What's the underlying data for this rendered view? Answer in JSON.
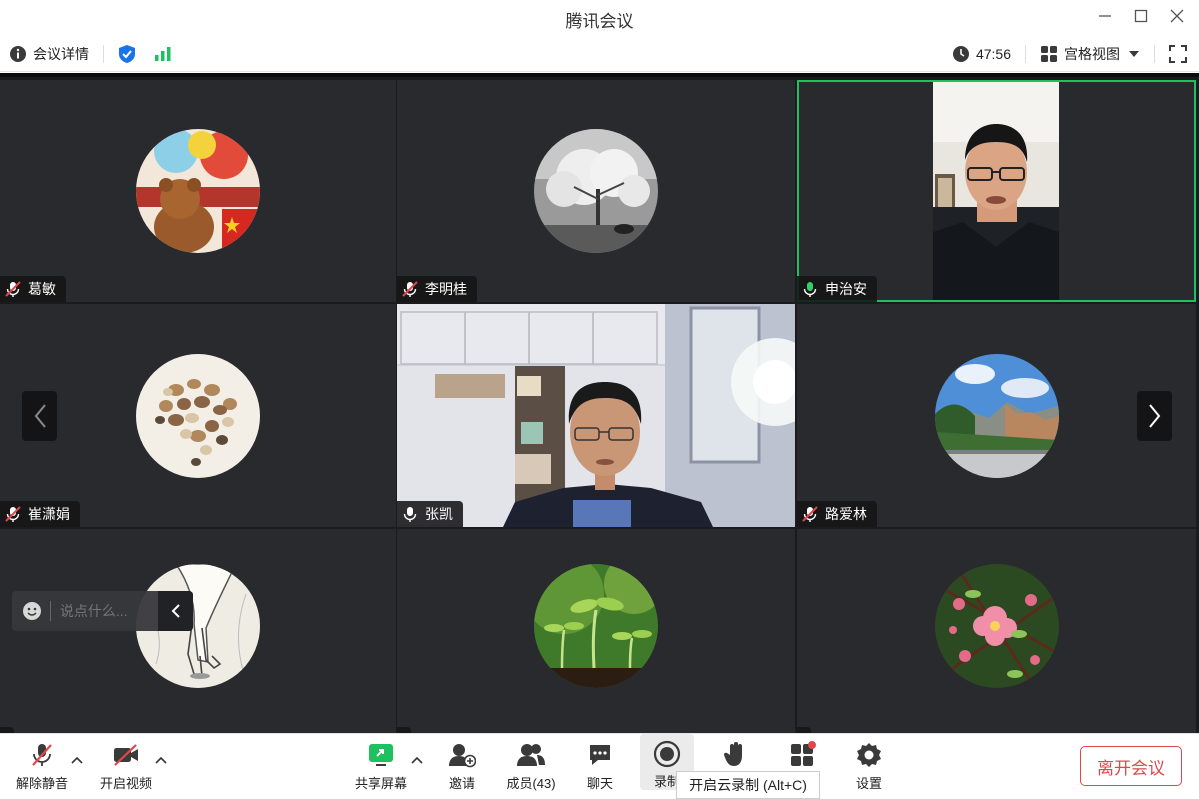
{
  "window": {
    "title": "腾讯会议"
  },
  "infobar": {
    "details_label": "会议详情",
    "timer": "47:56",
    "view_label": "宫格视图"
  },
  "tiles": [
    {
      "name": "葛敏",
      "mic": "muted"
    },
    {
      "name": "李明桂",
      "mic": "muted"
    },
    {
      "name": "申治安",
      "mic": "on",
      "active": true
    },
    {
      "name": "崔潇娟",
      "mic": "muted"
    },
    {
      "name": "张凯",
      "mic": "on"
    },
    {
      "name": "路爱林",
      "mic": "muted"
    }
  ],
  "chat": {
    "placeholder": "说点什么..."
  },
  "toolbar": {
    "unmute": "解除静音",
    "video": "开启视频",
    "share": "共享屏幕",
    "invite": "邀请",
    "members": "成员(43)",
    "chat": "聊天",
    "record": "录制",
    "raise": "",
    "apps": "",
    "settings": "设置",
    "leave": "离开会议"
  },
  "tooltip": {
    "text": "开启云录制 (Alt+C)"
  },
  "colors": {
    "active_border": "#1ec15f",
    "leave": "#e0474c",
    "mic_on": "#2fd06a"
  }
}
